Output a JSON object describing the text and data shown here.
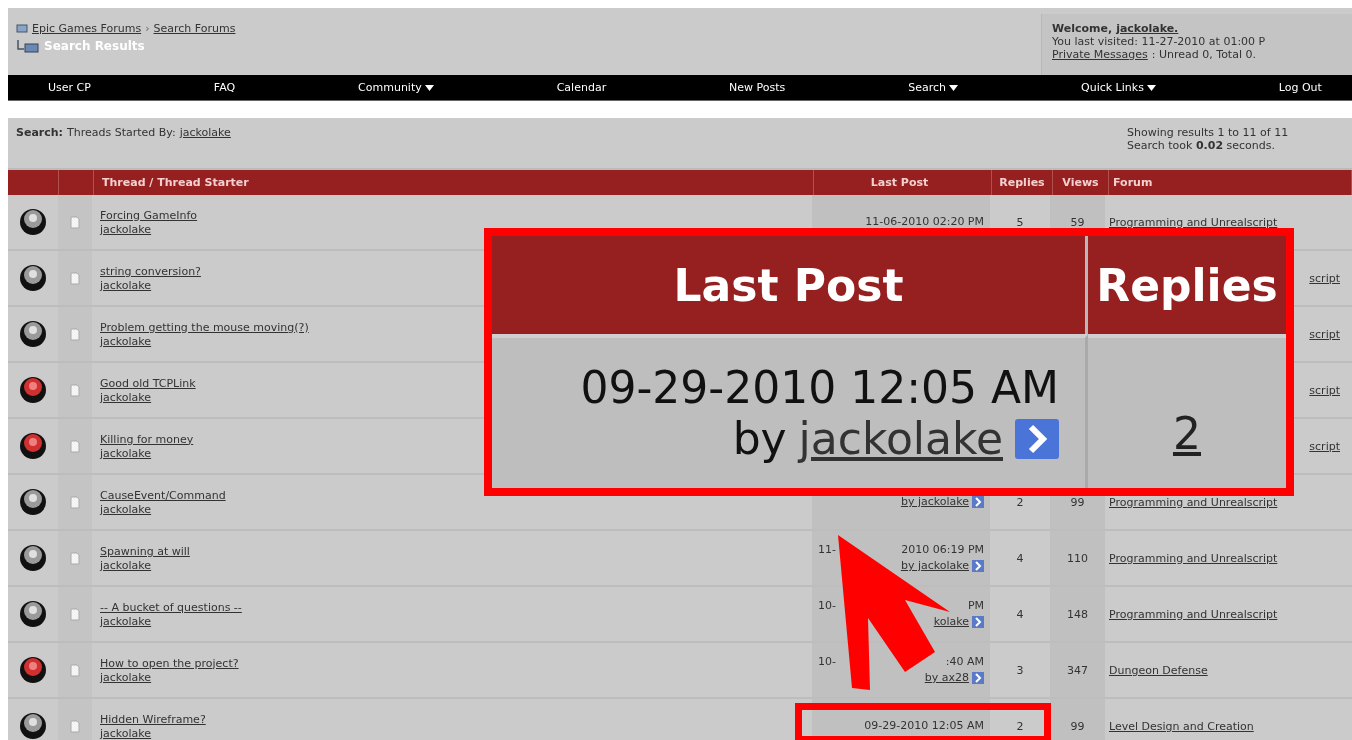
{
  "header": {
    "breadcrumb": [
      "Epic Games Forums",
      "Search Forums"
    ],
    "breadcrumb_separator": "›",
    "page_title": "Search Results",
    "welcome": {
      "greeting": "Welcome,",
      "user": "jackolake.",
      "last_visited": "You last visited: 11-27-2010 at 01:00 P",
      "messages_link": "Private Messages",
      "messages": ": Unread 0, Total 0."
    }
  },
  "navbar": [
    {
      "label": "User CP",
      "menu": false
    },
    {
      "label": "FAQ",
      "menu": false
    },
    {
      "label": "Community",
      "menu": true
    },
    {
      "label": "Calendar",
      "menu": false
    },
    {
      "label": "New Posts",
      "menu": false
    },
    {
      "label": "Search",
      "menu": true
    },
    {
      "label": "Quick Links",
      "menu": true
    },
    {
      "label": "Log Out",
      "menu": false
    }
  ],
  "search": {
    "label": "Search:",
    "criteria": "Threads Started By:",
    "user": "jackolake",
    "showing": "Showing results 1 to 11 of 11",
    "took": "Search took **0.02** seconds."
  },
  "table": {
    "columns": [
      "Thread / Thread Starter",
      "Last Post",
      "Replies",
      "Views",
      "Forum"
    ],
    "rows": [
      {
        "hot": false,
        "title": "Forcing GameInfo",
        "starter": "jackolake",
        "last_post": "11-06-2010 02:20 PM",
        "replies": "5",
        "views": "59",
        "forum": "Programming and Unrealscript"
      },
      {
        "hot": false,
        "title": "string conversion?",
        "starter": "jackolake",
        "forum": "script",
        "forum_partial": true
      },
      {
        "hot": false,
        "title": "Problem getting the mouse moving(?)",
        "starter": "jackolake",
        "forum": "script",
        "forum_partial": true
      },
      {
        "hot": true,
        "title": "Good old TCPLink",
        "starter": "jackolake",
        "forum": "script",
        "forum_partial": true
      },
      {
        "hot": true,
        "title": "Killing for money",
        "starter": "jackolake",
        "forum": "script",
        "forum_partial": true
      },
      {
        "hot": false,
        "title": "CauseEvent/Command",
        "starter": "jackolake",
        "last_by": "by jackolake",
        "replies": "2",
        "views": "99",
        "forum": "Programming and Unrealscript"
      },
      {
        "hot": false,
        "title": "Spawning at will",
        "starter": "jackolake",
        "last_post_start": "11-",
        "last_post": "2010 06:19 PM",
        "last_by": "by jackolake",
        "replies": "4",
        "views": "110",
        "forum": "Programming and Unrealscript"
      },
      {
        "hot": false,
        "title": "-- A bucket of questions --",
        "starter": "jackolake",
        "last_post_start": "10-",
        "last_post": "PM",
        "last_by": "kolake",
        "replies": "4",
        "views": "148",
        "forum": "Programming and Unrealscript"
      },
      {
        "hot": true,
        "title": "How to open the project?",
        "starter": "jackolake",
        "last_post_start": "10-",
        "last_post": ":40 AM",
        "last_by": "by ax28",
        "replies": "3",
        "views": "347",
        "forum": "Dungeon Defense"
      },
      {
        "hot": false,
        "title": "Hidden Wireframe?",
        "starter": "jackolake",
        "last_post": "09-29-2010 12:05 AM",
        "replies": "2",
        "views": "99",
        "forum": "Level Design and Creation"
      }
    ]
  },
  "callout": {
    "columns": [
      "Last Post",
      "Replies"
    ],
    "date": "09-29-2010 12:05 AM",
    "by": "by",
    "user": "jackolake",
    "replies": "2"
  }
}
